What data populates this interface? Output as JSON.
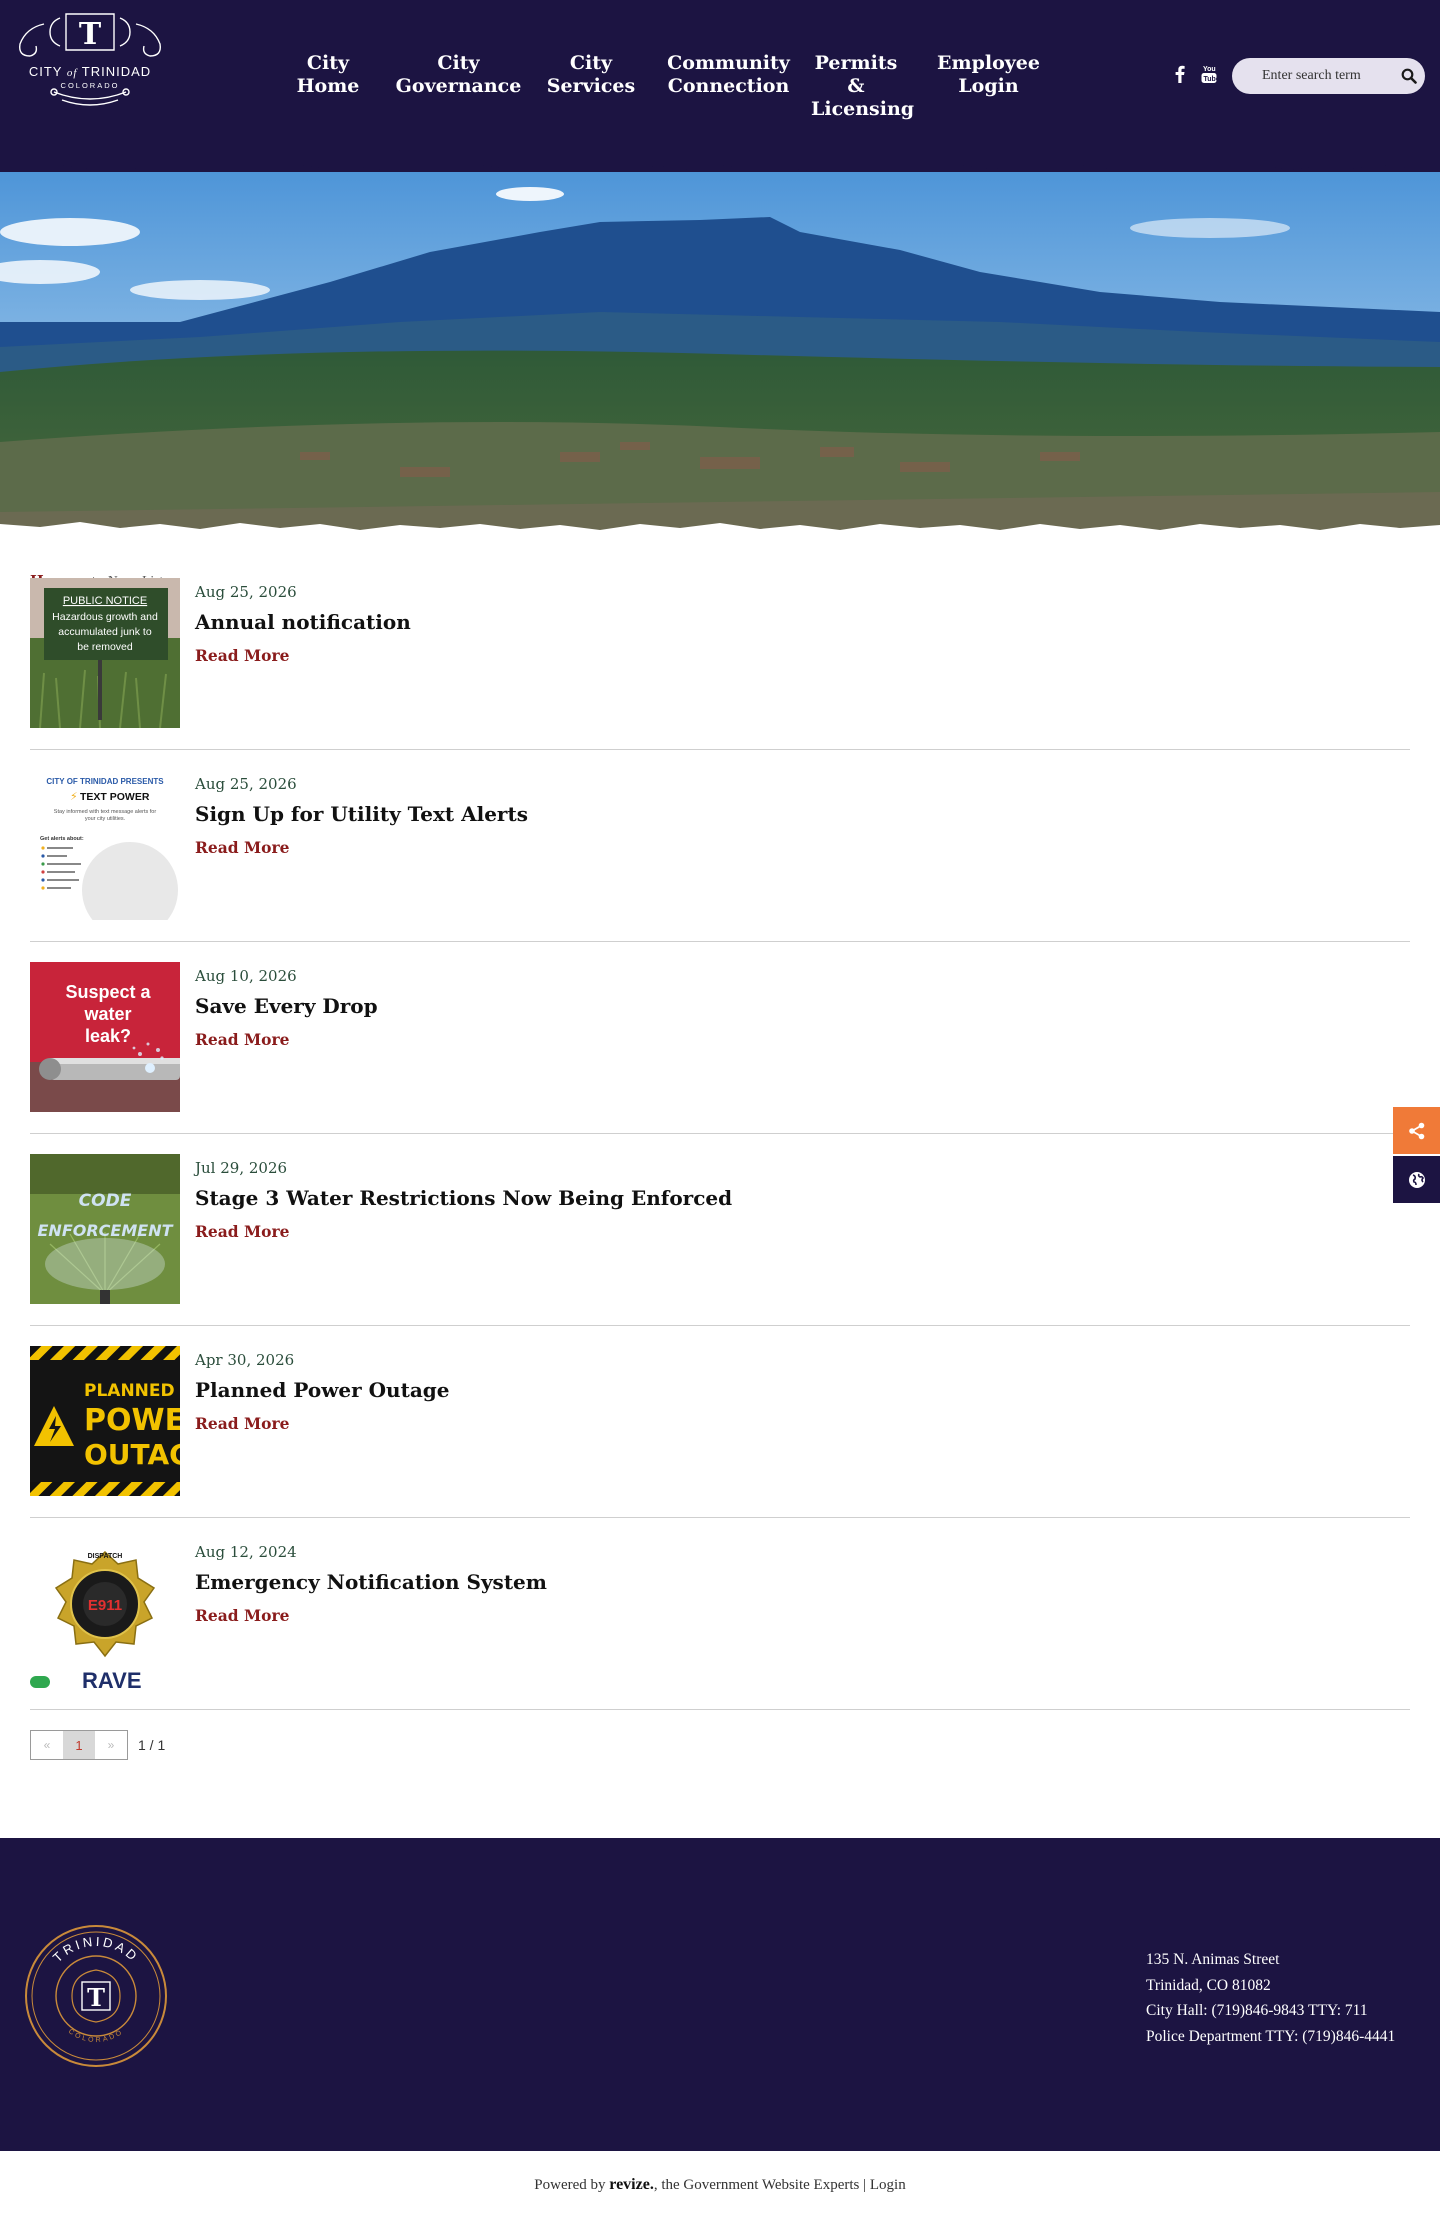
{
  "site": {
    "logo_text": {
      "city": "CITY",
      "of": "of",
      "name": "TRINIDAD",
      "state": "COLORADO"
    }
  },
  "nav": {
    "items": [
      {
        "line1": "City",
        "line2": "Home"
      },
      {
        "line1": "City",
        "line2": "Governance"
      },
      {
        "line1": "City",
        "line2": "Services"
      },
      {
        "line1": "Community",
        "line2": "Connection"
      },
      {
        "line1": "Permits &",
        "line2": "Licensing"
      },
      {
        "line1": "Employee",
        "line2": "Login"
      }
    ]
  },
  "search": {
    "placeholder": "Enter search term"
  },
  "breadcrumb": {
    "home": "Home",
    "current": "News List"
  },
  "news": [
    {
      "date": "Aug 25, 2026",
      "title": "Annual notification",
      "more": "Read More",
      "thumb": {
        "icon": "public-notice-image",
        "heading": "PUBLIC NOTICE",
        "l1": "Hazardous growth and",
        "l2": "accumulated junk to",
        "l3": "be removed"
      }
    },
    {
      "date": "Aug 25, 2026",
      "title": "Sign Up for Utility Text Alerts",
      "more": "Read More",
      "thumb": {
        "icon": "text-power-image",
        "heading": "CITY OF TRINIDAD PRESENTS",
        "sub": "TEXT POWER",
        "l1": "Stay informed with text message alerts for",
        "l2": "your city utilities.",
        "l3": "Get alerts about:"
      }
    },
    {
      "date": "Aug 10, 2026",
      "title": "Save Every Drop",
      "more": "Read More",
      "thumb": {
        "icon": "water-leak-image",
        "l1": "Suspect a",
        "l2": "water",
        "l3": "leak?"
      }
    },
    {
      "date": "Jul 29, 2026",
      "title": "Stage 3 Water Restrictions Now Being Enforced",
      "more": "Read More",
      "thumb": {
        "icon": "code-enforcement-image",
        "l1": "CODE",
        "l2": "ENFORCEMENT"
      }
    },
    {
      "date": "Apr 30, 2026",
      "title": "Planned Power Outage",
      "more": "Read More",
      "thumb": {
        "icon": "power-outage-image",
        "l1": "PLANNED",
        "l2": "POWE",
        "l3": "OUTAG"
      }
    },
    {
      "date": "Aug 12, 2024",
      "title": "Emergency Notification System",
      "more": "Read More",
      "thumb": {
        "icon": "dispatch-badge-image",
        "l1": "DISPATCH",
        "l2": "E911",
        "l3": "RAVE"
      }
    }
  ],
  "pager": {
    "prev": "«",
    "current": "1",
    "next": "»",
    "count": "1 / 1"
  },
  "footer": {
    "seal": {
      "top": "TRINIDAD",
      "bottom": "COLORADO",
      "letter": "T"
    },
    "address": [
      "135 N. Animas Street",
      "Trinidad, CO 81082",
      "City Hall: (719)846-9843 TTY: 711",
      "Police Department TTY: (719)846-4441"
    ]
  },
  "bottom": {
    "powered": "Powered by",
    "brand": "revize.",
    "tagline": ", the Government Website Experts",
    "sep": "|",
    "login": "Login"
  },
  "colors": {
    "navy": "#1c1442",
    "maroon": "#8a1c1c",
    "orange": "#f07a38"
  }
}
